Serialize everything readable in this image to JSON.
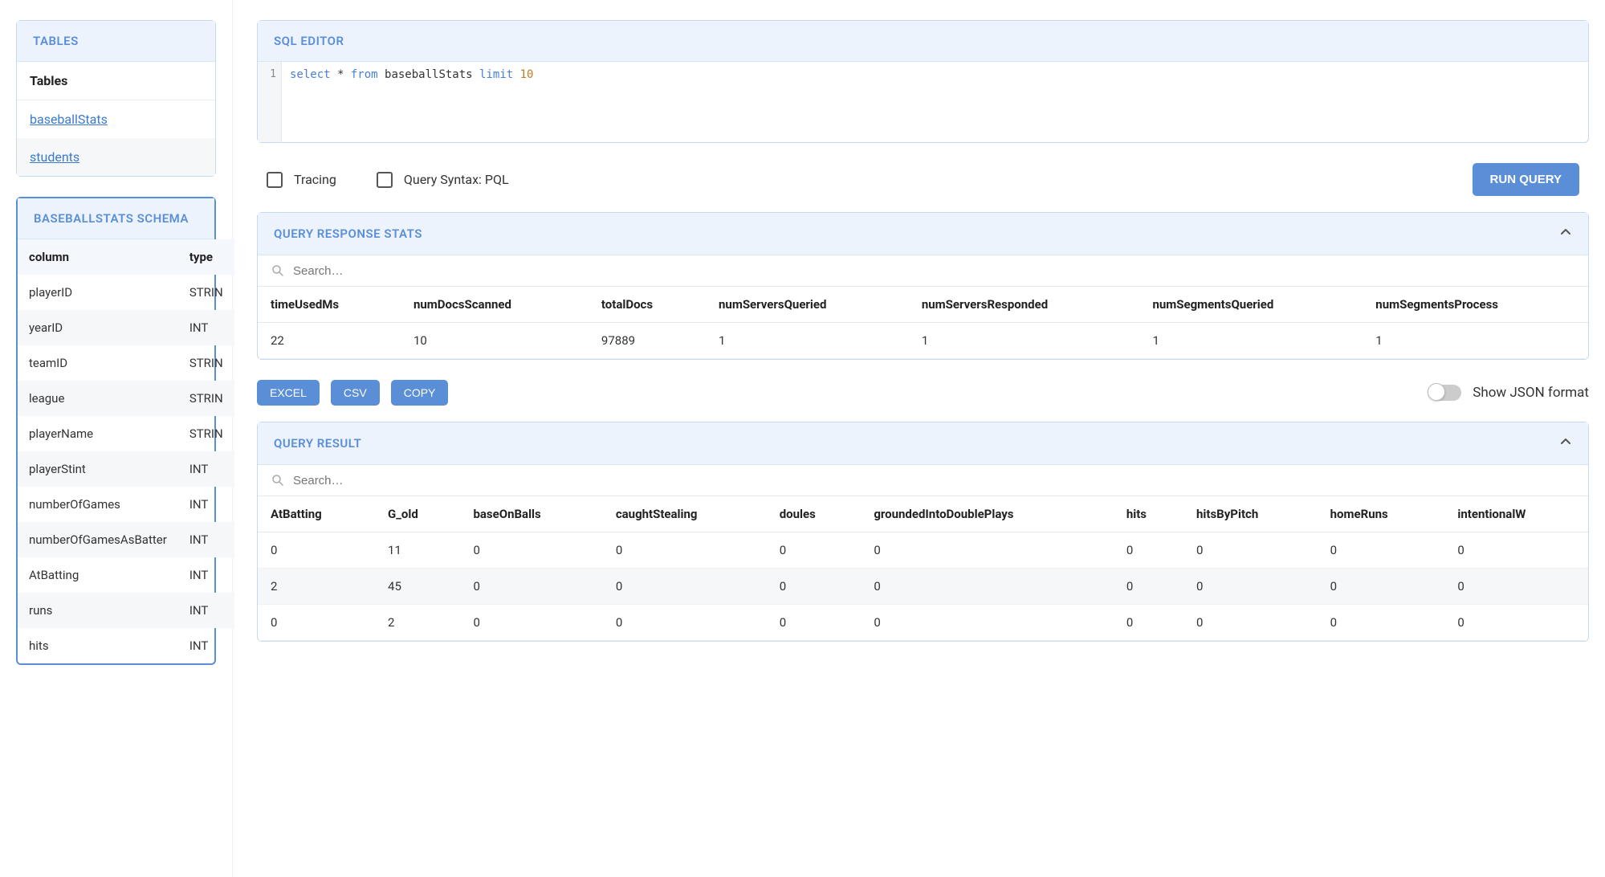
{
  "sidebar": {
    "tables_panel_title": "TABLES",
    "tables_header": "Tables",
    "tables": [
      "baseballStats",
      "students"
    ],
    "schema_panel_title": "BASEBALLSTATS SCHEMA",
    "schema_headers": {
      "col": "column",
      "type": "type"
    },
    "schema_rows": [
      {
        "col": "playerID",
        "type": "STRIN"
      },
      {
        "col": "yearID",
        "type": "INT"
      },
      {
        "col": "teamID",
        "type": "STRIN"
      },
      {
        "col": "league",
        "type": "STRIN"
      },
      {
        "col": "playerName",
        "type": "STRIN"
      },
      {
        "col": "playerStint",
        "type": "INT"
      },
      {
        "col": "numberOfGames",
        "type": "INT"
      },
      {
        "col": "numberOfGamesAsBatter",
        "type": "INT"
      },
      {
        "col": "AtBatting",
        "type": "INT"
      },
      {
        "col": "runs",
        "type": "INT"
      },
      {
        "col": "hits",
        "type": "INT"
      }
    ]
  },
  "editor": {
    "panel_title": "SQL EDITOR",
    "line_number": "1",
    "sql_tokens": [
      {
        "t": "select",
        "c": "kw-blue"
      },
      {
        "t": " * ",
        "c": ""
      },
      {
        "t": "from",
        "c": "kw-blue"
      },
      {
        "t": " baseballStats ",
        "c": ""
      },
      {
        "t": "limit",
        "c": "kw-blue"
      },
      {
        "t": " ",
        "c": ""
      },
      {
        "t": "10",
        "c": "kw-orange"
      }
    ],
    "tracing_label": "Tracing",
    "syntax_label": "Query Syntax: PQL",
    "run_label": "RUN QUERY"
  },
  "stats": {
    "panel_title": "QUERY RESPONSE STATS",
    "search_placeholder": "Search…",
    "headers": [
      "timeUsedMs",
      "numDocsScanned",
      "totalDocs",
      "numServersQueried",
      "numServersResponded",
      "numSegmentsQueried",
      "numSegmentsProcess"
    ],
    "row": [
      "22",
      "10",
      "97889",
      "1",
      "1",
      "1",
      "1"
    ]
  },
  "export": {
    "excel": "EXCEL",
    "csv": "CSV",
    "copy": "COPY",
    "json_label": "Show JSON format"
  },
  "result": {
    "panel_title": "QUERY RESULT",
    "search_placeholder": "Search…",
    "headers": [
      "AtBatting",
      "G_old",
      "baseOnBalls",
      "caughtStealing",
      "doules",
      "groundedIntoDoublePlays",
      "hits",
      "hitsByPitch",
      "homeRuns",
      "intentionalW"
    ],
    "rows": [
      [
        "0",
        "11",
        "0",
        "0",
        "0",
        "0",
        "0",
        "0",
        "0",
        "0"
      ],
      [
        "2",
        "45",
        "0",
        "0",
        "0",
        "0",
        "0",
        "0",
        "0",
        "0"
      ],
      [
        "0",
        "2",
        "0",
        "0",
        "0",
        "0",
        "0",
        "0",
        "0",
        "0"
      ]
    ]
  }
}
